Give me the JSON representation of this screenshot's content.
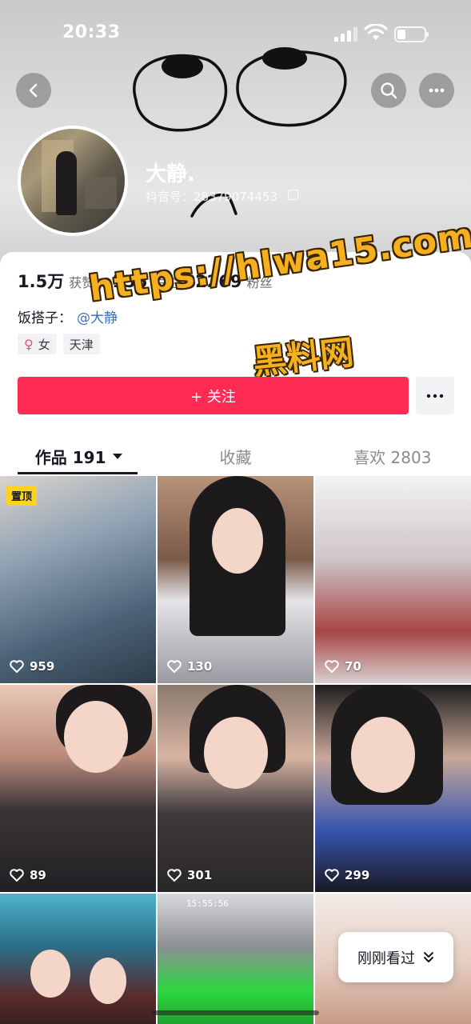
{
  "status_bar": {
    "time": "20:33"
  },
  "profile": {
    "nickname": "大静.",
    "douyin_id": "抖音号：28379074453"
  },
  "stats": [
    {
      "value": "1.5万",
      "label": "获赞"
    },
    {
      "value": "156",
      "label": "关注"
    },
    {
      "value": "2269",
      "label": "粉丝"
    }
  ],
  "bio": {
    "prefix": "饭搭子：",
    "mention": "@大静"
  },
  "tags": {
    "gender": "女",
    "location": "天津"
  },
  "follow_button": {
    "label": "+ 关注"
  },
  "watermark": {
    "url": "https://hlwa15.com",
    "name": "黑料网"
  },
  "tabs": [
    {
      "label": "作品 191",
      "active": true
    },
    {
      "label": "收藏",
      "active": false
    },
    {
      "label": "喜欢 2803",
      "active": false
    }
  ],
  "grid": {
    "pinned_label": "置顶",
    "items": [
      {
        "likes": "959"
      },
      {
        "likes": "130"
      },
      {
        "likes": "70"
      },
      {
        "likes": "89"
      },
      {
        "likes": "301"
      },
      {
        "likes": "299"
      },
      {
        "likes": ""
      },
      {
        "likes": ""
      },
      {
        "likes": ""
      }
    ],
    "overlay_time": "15:55:56"
  },
  "recent_button": {
    "label": "刚刚看过"
  },
  "colors": {
    "accent": "#fe2c55",
    "link": "#3b6fb6",
    "pinned": "#ffd21e"
  }
}
